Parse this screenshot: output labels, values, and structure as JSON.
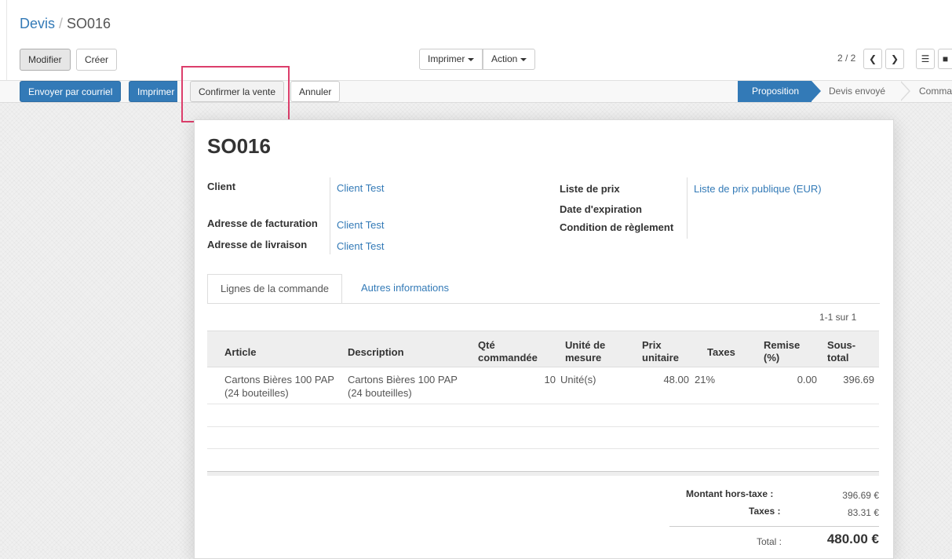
{
  "breadcrumb": {
    "parent": "Devis",
    "separator": "/",
    "current": "SO016"
  },
  "toolbar": {
    "edit_label": "Modifier",
    "create_label": "Créer",
    "print_label": "Imprimer",
    "action_label": "Action",
    "pager_text": "2 / 2"
  },
  "actionbar": {
    "send_email_label": "Envoyer par courriel",
    "print_label": "Imprimer",
    "confirm_label": "Confirmer la vente",
    "cancel_label": "Annuler"
  },
  "status_steps": [
    "Proposition",
    "Devis envoyé",
    "Comma"
  ],
  "sheet": {
    "title": "SO016",
    "fields_left": [
      {
        "label": "Client",
        "value": "Client Test"
      },
      {
        "label": "Adresse de facturation",
        "value": "Client Test"
      },
      {
        "label": "Adresse de livraison",
        "value": "Client Test"
      }
    ],
    "fields_right": [
      {
        "label": "Liste de prix",
        "value": "Liste de prix publique (EUR)"
      },
      {
        "label": "Date d'expiration",
        "value": ""
      },
      {
        "label": "Condition de règlement",
        "value": ""
      }
    ],
    "tabs": [
      "Lignes de la commande",
      "Autres informations"
    ],
    "list_pager": "1-1 sur 1",
    "table": {
      "headers": [
        "Article",
        "Description",
        "Qté commandée",
        "Unité de mesure",
        "Prix unitaire",
        "Taxes",
        "Remise (%)",
        "Sous-total"
      ],
      "rows": [
        {
          "article": "Cartons Bières 100 PAP (24 bouteilles)",
          "description": "Cartons Bières 100 PAP (24 bouteilles)",
          "qty": "10",
          "uom": "Unité(s)",
          "price": "48.00",
          "taxes": "21%",
          "discount": "0.00",
          "subtotal": "396.69"
        }
      ]
    },
    "totals": {
      "untaxed_label": "Montant hors-taxe :",
      "untaxed_value": "396.69 €",
      "taxes_label": "Taxes :",
      "taxes_value": "83.31 €",
      "total_label": "Total :",
      "total_value": "480.00 €"
    }
  },
  "colors": {
    "primary": "#337ab7",
    "highlight": "#dc3e6b"
  }
}
